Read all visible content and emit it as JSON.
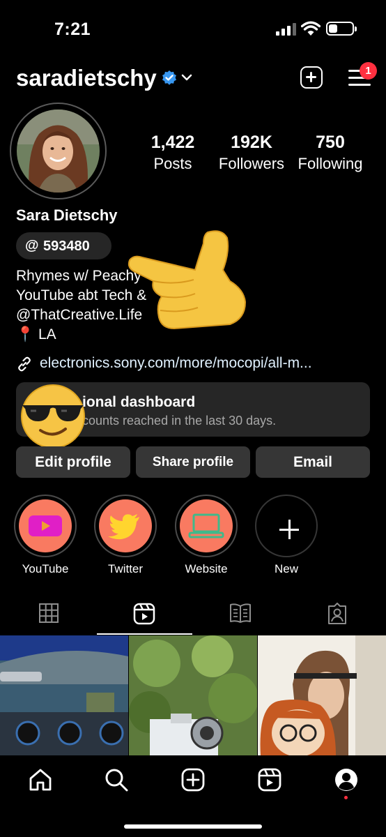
{
  "status_bar": {
    "time": "7:21"
  },
  "header": {
    "username": "saradietschy",
    "notification_count": "1"
  },
  "profile": {
    "full_name": "Sara Dietschy",
    "threads_badge_icon": "@",
    "threads_count": "593480",
    "bio_lines": [
      "Rhymes w/ Peachy",
      "YouTube abt Tech &",
      "@ThatCreative.Life",
      "📍 LA"
    ],
    "link": "electronics.sony.com/more/mocopi/all-m..."
  },
  "stats": [
    {
      "value": "1,422",
      "label": "Posts"
    },
    {
      "value": "192K",
      "label": "Followers"
    },
    {
      "value": "750",
      "label": "Following"
    }
  ],
  "dashboard": {
    "title": "ional dashboard",
    "subtitle": "counts reached in the last 30 days."
  },
  "buttons": {
    "edit": "Edit profile",
    "share": "Share profile",
    "email": "Email"
  },
  "highlights": [
    {
      "label": "YouTube",
      "icon": "youtube-icon"
    },
    {
      "label": "Twitter",
      "icon": "twitter-icon"
    },
    {
      "label": "Website",
      "icon": "laptop-icon"
    },
    {
      "label": "New",
      "icon": "plus-icon"
    }
  ],
  "tabs": [
    "grid-icon",
    "reels-icon",
    "guides-icon",
    "tagged-icon"
  ],
  "bottom_nav": [
    "home-icon",
    "search-icon",
    "create-icon",
    "reels-icon",
    "profile-icon"
  ],
  "colors": {
    "accent_red": "#ff3040",
    "highlight_bg": "#f97a61",
    "verified_blue": "#3897f0",
    "card_bg": "#262626"
  }
}
